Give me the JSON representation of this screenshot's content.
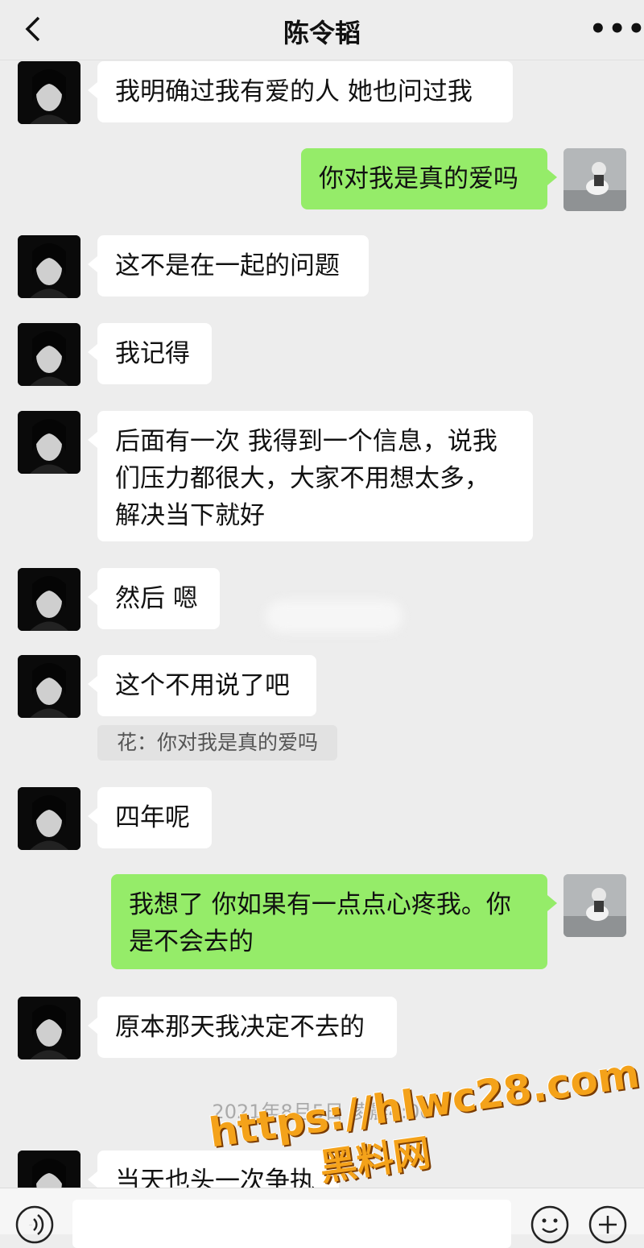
{
  "header": {
    "title": "陈令韬",
    "more": "•••"
  },
  "messages": [
    {
      "side": "left",
      "text": "我明确过我有爱的人 她也问过我"
    },
    {
      "side": "right",
      "text": "你对我是真的爱吗"
    },
    {
      "side": "left",
      "text": "这不是在一起的问题"
    },
    {
      "side": "left",
      "text": "我记得"
    },
    {
      "side": "left",
      "lines": [
        "后面有一次 我得到一个信息，说我",
        "们压力都很大，大家不用想太多，",
        "解决当下就好"
      ]
    },
    {
      "side": "left",
      "text": "然后 嗯"
    },
    {
      "side": "left",
      "text": "这个不用说了吧"
    },
    {
      "side": "left",
      "text": "四年呢"
    },
    {
      "side": "right",
      "lines": [
        "我想了 你如果有一点点心疼我。你",
        "是不会去的"
      ]
    },
    {
      "side": "left",
      "text": "原本那天我决定不去的"
    },
    {
      "side": "left",
      "text": "当天也头一次争执"
    }
  ],
  "quote": {
    "text": "花：你对我是真的爱吗"
  },
  "timestamp": "2021年8月5日 凌晨4:00",
  "watermark": {
    "url": "https://hlwc28.com",
    "cn": "黑料网"
  },
  "colors": {
    "background": "#ededed",
    "incoming_bubble": "#ffffff",
    "outgoing_bubble": "#95ec69",
    "watermark": "#f4a21a"
  }
}
